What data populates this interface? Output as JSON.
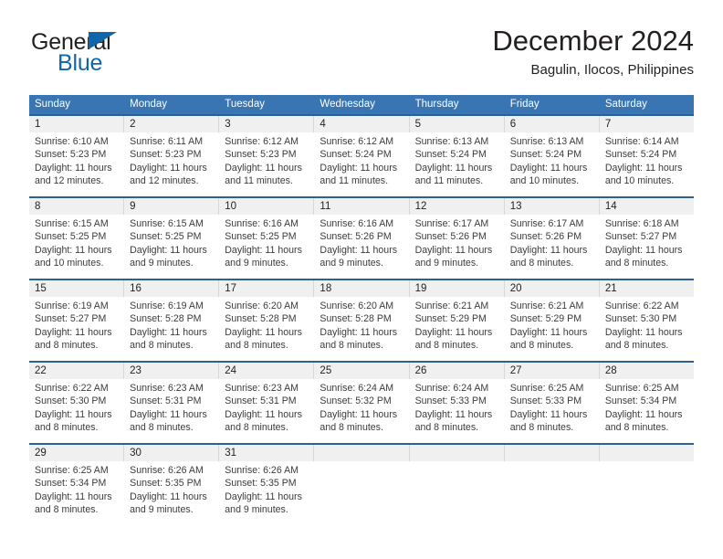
{
  "brand": {
    "name_part1": "General",
    "name_part2": "Blue",
    "triangle_icon": "triangle-icon",
    "color_dark": "#231f20",
    "color_blue": "#1066ab"
  },
  "header": {
    "title": "December 2024",
    "subtitle": "Bagulin, Ilocos, Philippines"
  },
  "theme": {
    "header_bg": "#3a75b3",
    "header_text": "#ffffff",
    "date_strip_bg": "#f0f0f0",
    "week_divider": "#2e6193",
    "body_text": "#3b3b3b"
  },
  "calendar": {
    "weekday_headers": [
      "Sunday",
      "Monday",
      "Tuesday",
      "Wednesday",
      "Thursday",
      "Friday",
      "Saturday"
    ],
    "labels": {
      "sunrise": "Sunrise:",
      "sunset": "Sunset:",
      "daylight": "Daylight:"
    },
    "weeks": [
      {
        "days": [
          {
            "date": "1",
            "sunrise": "Sunrise: 6:10 AM",
            "sunset": "Sunset: 5:23 PM",
            "daylight_1": "Daylight: 11 hours",
            "daylight_2": "and 12 minutes."
          },
          {
            "date": "2",
            "sunrise": "Sunrise: 6:11 AM",
            "sunset": "Sunset: 5:23 PM",
            "daylight_1": "Daylight: 11 hours",
            "daylight_2": "and 12 minutes."
          },
          {
            "date": "3",
            "sunrise": "Sunrise: 6:12 AM",
            "sunset": "Sunset: 5:23 PM",
            "daylight_1": "Daylight: 11 hours",
            "daylight_2": "and 11 minutes."
          },
          {
            "date": "4",
            "sunrise": "Sunrise: 6:12 AM",
            "sunset": "Sunset: 5:24 PM",
            "daylight_1": "Daylight: 11 hours",
            "daylight_2": "and 11 minutes."
          },
          {
            "date": "5",
            "sunrise": "Sunrise: 6:13 AM",
            "sunset": "Sunset: 5:24 PM",
            "daylight_1": "Daylight: 11 hours",
            "daylight_2": "and 11 minutes."
          },
          {
            "date": "6",
            "sunrise": "Sunrise: 6:13 AM",
            "sunset": "Sunset: 5:24 PM",
            "daylight_1": "Daylight: 11 hours",
            "daylight_2": "and 10 minutes."
          },
          {
            "date": "7",
            "sunrise": "Sunrise: 6:14 AM",
            "sunset": "Sunset: 5:24 PM",
            "daylight_1": "Daylight: 11 hours",
            "daylight_2": "and 10 minutes."
          }
        ]
      },
      {
        "days": [
          {
            "date": "8",
            "sunrise": "Sunrise: 6:15 AM",
            "sunset": "Sunset: 5:25 PM",
            "daylight_1": "Daylight: 11 hours",
            "daylight_2": "and 10 minutes."
          },
          {
            "date": "9",
            "sunrise": "Sunrise: 6:15 AM",
            "sunset": "Sunset: 5:25 PM",
            "daylight_1": "Daylight: 11 hours",
            "daylight_2": "and 9 minutes."
          },
          {
            "date": "10",
            "sunrise": "Sunrise: 6:16 AM",
            "sunset": "Sunset: 5:25 PM",
            "daylight_1": "Daylight: 11 hours",
            "daylight_2": "and 9 minutes."
          },
          {
            "date": "11",
            "sunrise": "Sunrise: 6:16 AM",
            "sunset": "Sunset: 5:26 PM",
            "daylight_1": "Daylight: 11 hours",
            "daylight_2": "and 9 minutes."
          },
          {
            "date": "12",
            "sunrise": "Sunrise: 6:17 AM",
            "sunset": "Sunset: 5:26 PM",
            "daylight_1": "Daylight: 11 hours",
            "daylight_2": "and 9 minutes."
          },
          {
            "date": "13",
            "sunrise": "Sunrise: 6:17 AM",
            "sunset": "Sunset: 5:26 PM",
            "daylight_1": "Daylight: 11 hours",
            "daylight_2": "and 8 minutes."
          },
          {
            "date": "14",
            "sunrise": "Sunrise: 6:18 AM",
            "sunset": "Sunset: 5:27 PM",
            "daylight_1": "Daylight: 11 hours",
            "daylight_2": "and 8 minutes."
          }
        ]
      },
      {
        "days": [
          {
            "date": "15",
            "sunrise": "Sunrise: 6:19 AM",
            "sunset": "Sunset: 5:27 PM",
            "daylight_1": "Daylight: 11 hours",
            "daylight_2": "and 8 minutes."
          },
          {
            "date": "16",
            "sunrise": "Sunrise: 6:19 AM",
            "sunset": "Sunset: 5:28 PM",
            "daylight_1": "Daylight: 11 hours",
            "daylight_2": "and 8 minutes."
          },
          {
            "date": "17",
            "sunrise": "Sunrise: 6:20 AM",
            "sunset": "Sunset: 5:28 PM",
            "daylight_1": "Daylight: 11 hours",
            "daylight_2": "and 8 minutes."
          },
          {
            "date": "18",
            "sunrise": "Sunrise: 6:20 AM",
            "sunset": "Sunset: 5:28 PM",
            "daylight_1": "Daylight: 11 hours",
            "daylight_2": "and 8 minutes."
          },
          {
            "date": "19",
            "sunrise": "Sunrise: 6:21 AM",
            "sunset": "Sunset: 5:29 PM",
            "daylight_1": "Daylight: 11 hours",
            "daylight_2": "and 8 minutes."
          },
          {
            "date": "20",
            "sunrise": "Sunrise: 6:21 AM",
            "sunset": "Sunset: 5:29 PM",
            "daylight_1": "Daylight: 11 hours",
            "daylight_2": "and 8 minutes."
          },
          {
            "date": "21",
            "sunrise": "Sunrise: 6:22 AM",
            "sunset": "Sunset: 5:30 PM",
            "daylight_1": "Daylight: 11 hours",
            "daylight_2": "and 8 minutes."
          }
        ]
      },
      {
        "days": [
          {
            "date": "22",
            "sunrise": "Sunrise: 6:22 AM",
            "sunset": "Sunset: 5:30 PM",
            "daylight_1": "Daylight: 11 hours",
            "daylight_2": "and 8 minutes."
          },
          {
            "date": "23",
            "sunrise": "Sunrise: 6:23 AM",
            "sunset": "Sunset: 5:31 PM",
            "daylight_1": "Daylight: 11 hours",
            "daylight_2": "and 8 minutes."
          },
          {
            "date": "24",
            "sunrise": "Sunrise: 6:23 AM",
            "sunset": "Sunset: 5:31 PM",
            "daylight_1": "Daylight: 11 hours",
            "daylight_2": "and 8 minutes."
          },
          {
            "date": "25",
            "sunrise": "Sunrise: 6:24 AM",
            "sunset": "Sunset: 5:32 PM",
            "daylight_1": "Daylight: 11 hours",
            "daylight_2": "and 8 minutes."
          },
          {
            "date": "26",
            "sunrise": "Sunrise: 6:24 AM",
            "sunset": "Sunset: 5:33 PM",
            "daylight_1": "Daylight: 11 hours",
            "daylight_2": "and 8 minutes."
          },
          {
            "date": "27",
            "sunrise": "Sunrise: 6:25 AM",
            "sunset": "Sunset: 5:33 PM",
            "daylight_1": "Daylight: 11 hours",
            "daylight_2": "and 8 minutes."
          },
          {
            "date": "28",
            "sunrise": "Sunrise: 6:25 AM",
            "sunset": "Sunset: 5:34 PM",
            "daylight_1": "Daylight: 11 hours",
            "daylight_2": "and 8 minutes."
          }
        ]
      },
      {
        "days": [
          {
            "date": "29",
            "sunrise": "Sunrise: 6:25 AM",
            "sunset": "Sunset: 5:34 PM",
            "daylight_1": "Daylight: 11 hours",
            "daylight_2": "and 8 minutes."
          },
          {
            "date": "30",
            "sunrise": "Sunrise: 6:26 AM",
            "sunset": "Sunset: 5:35 PM",
            "daylight_1": "Daylight: 11 hours",
            "daylight_2": "and 9 minutes."
          },
          {
            "date": "31",
            "sunrise": "Sunrise: 6:26 AM",
            "sunset": "Sunset: 5:35 PM",
            "daylight_1": "Daylight: 11 hours",
            "daylight_2": "and 9 minutes."
          },
          {
            "date": "",
            "sunrise": "",
            "sunset": "",
            "daylight_1": "",
            "daylight_2": ""
          },
          {
            "date": "",
            "sunrise": "",
            "sunset": "",
            "daylight_1": "",
            "daylight_2": ""
          },
          {
            "date": "",
            "sunrise": "",
            "sunset": "",
            "daylight_1": "",
            "daylight_2": ""
          },
          {
            "date": "",
            "sunrise": "",
            "sunset": "",
            "daylight_1": "",
            "daylight_2": ""
          }
        ]
      }
    ]
  }
}
